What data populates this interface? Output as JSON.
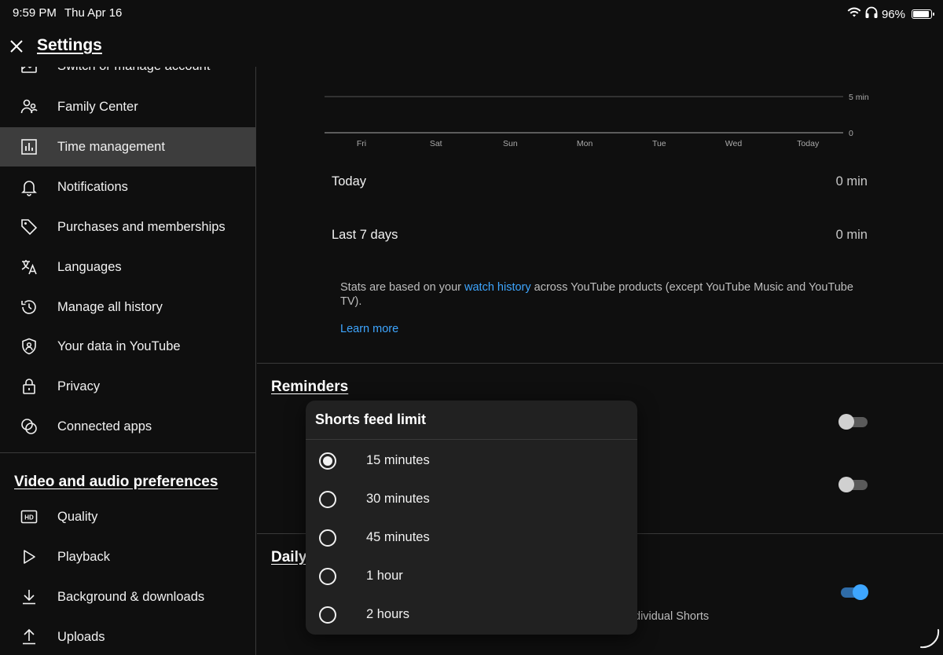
{
  "status_bar": {
    "time": "9:59 PM",
    "date": "Thu Apr 16",
    "battery": "96%"
  },
  "header": {
    "title": "Settings"
  },
  "sidebar": {
    "items": [
      {
        "label": "Switch or manage account",
        "icon": "switch-account-icon"
      },
      {
        "label": "Family Center",
        "icon": "family-icon"
      },
      {
        "label": "Time management",
        "icon": "chart-icon",
        "active": true
      },
      {
        "label": "Notifications",
        "icon": "bell-icon"
      },
      {
        "label": "Purchases and memberships",
        "icon": "tag-icon"
      },
      {
        "label": "Languages",
        "icon": "translate-icon"
      },
      {
        "label": "Manage all history",
        "icon": "history-icon"
      },
      {
        "label": "Your data in YouTube",
        "icon": "shield-person-icon"
      },
      {
        "label": "Privacy",
        "icon": "lock-icon"
      },
      {
        "label": "Connected apps",
        "icon": "connected-apps-icon"
      }
    ],
    "section_title": "Video and audio preferences",
    "section_items": [
      {
        "label": "Quality",
        "icon": "hd-icon"
      },
      {
        "label": "Playback",
        "icon": "play-icon"
      },
      {
        "label": "Background & downloads",
        "icon": "download-icon"
      },
      {
        "label": "Uploads",
        "icon": "upload-icon"
      }
    ]
  },
  "main": {
    "chart": {
      "days": [
        "Fri",
        "Sat",
        "Sun",
        "Mon",
        "Tue",
        "Wed",
        "Today"
      ],
      "y_max_label": "5 min",
      "y_min_label": "0"
    },
    "today_label": "Today",
    "today_value": "0 min",
    "week_label": "Last 7 days",
    "week_value": "0 min",
    "stats_note_prefix": "Stats are based on your ",
    "stats_note_link": "watch history",
    "stats_note_suffix": " across YouTube products (except YouTube Music and YouTube TV).",
    "learn_more": "Learn more",
    "reminders_title": "Reminders",
    "daily_title": "Daily",
    "daily_desc_fragment": "dividual Shorts"
  },
  "chart_data": {
    "type": "bar",
    "categories": [
      "Fri",
      "Sat",
      "Sun",
      "Mon",
      "Tue",
      "Wed",
      "Today"
    ],
    "values": [
      0,
      0,
      0,
      0,
      0,
      0,
      0
    ],
    "title": "",
    "xlabel": "",
    "ylabel": "",
    "y_tick_labels": [
      "0",
      "5 min"
    ],
    "ylim": [
      0,
      5
    ]
  },
  "dialog": {
    "title": "Shorts feed limit",
    "options": [
      {
        "label": "15 minutes",
        "checked": true
      },
      {
        "label": "30 minutes",
        "checked": false
      },
      {
        "label": "45 minutes",
        "checked": false
      },
      {
        "label": "1 hour",
        "checked": false
      },
      {
        "label": "2 hours",
        "checked": false
      }
    ]
  },
  "colors": {
    "background": "#0f0f0f",
    "active_item": "#3d3d3d",
    "link": "#3ea6ff",
    "dialog": "#212121"
  }
}
